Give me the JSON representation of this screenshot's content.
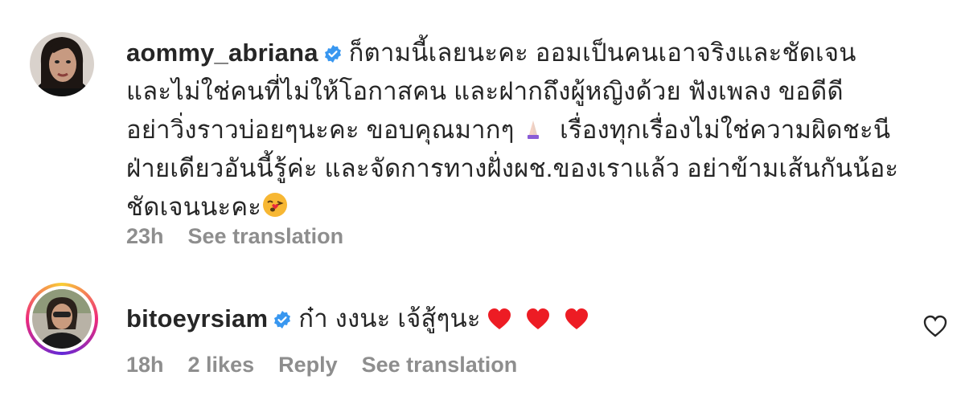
{
  "comments": [
    {
      "username": "aommy_abriana",
      "lines": [
        "ก็ตามนี้เลยนะคะ ออมเป็นคนเอาจริงและชัดเจน",
        "และไม่ใช่คนที่ไม่ให้โอกาสคน และฝากถึงผู้หญิงด้วย ฟังเพลง ขอดีดี",
        "อย่าวิ่งราวบ่อยๆนะคะ ขอบคุณมากๆ",
        "เรื่องทุกเรื่องไม่ใช่ความผิดชะนี",
        "ฝ่ายเดียวอันนี้รู้ค่ะ และจัดการทางฝั่งผช.ของเราแล้ว อย่าข้ามเส้นกันน้อะ",
        "ชัดเจนนะคะ"
      ],
      "time": "23h",
      "see_translation": "See translation"
    },
    {
      "username": "bitoeyrsiam",
      "text": "ก๋า งงนะ เจ้สู้ๆนะ",
      "time": "18h",
      "likes": "2 likes",
      "reply": "Reply",
      "see_translation": "See translation"
    }
  ],
  "colors": {
    "verified": "#3897f0",
    "heart": "#ed1c24",
    "meta": "#8e8e8e",
    "text": "#262626"
  },
  "icons": {
    "verified": "verified-badge-icon",
    "heart": "red-heart-icon",
    "like": "heart-outline-icon",
    "praying_hands": "praying-hands-emoji",
    "kiss": "face-blowing-kiss-emoji"
  }
}
